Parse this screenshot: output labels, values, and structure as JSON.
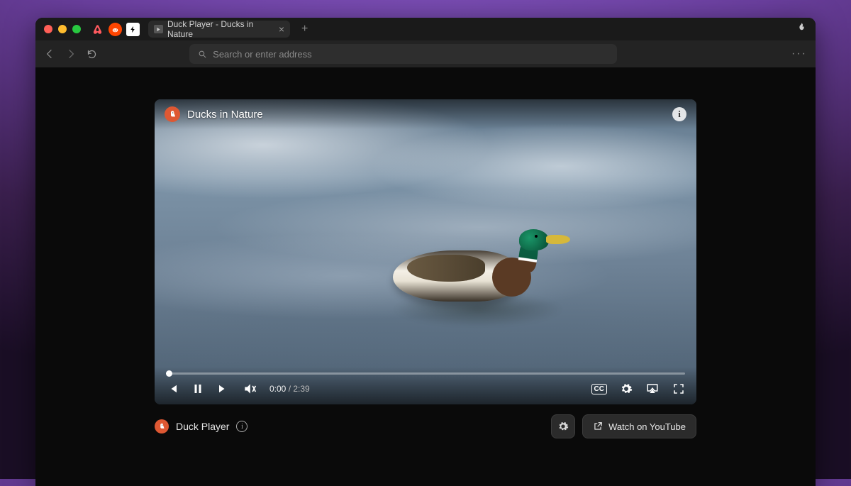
{
  "window": {
    "tab_title": "Duck Player - Ducks in Nature",
    "pinned_icons": [
      "airbnb",
      "reddit",
      "bolt"
    ]
  },
  "toolbar": {
    "search_placeholder": "Search or enter address"
  },
  "video": {
    "title": "Ducks in Nature",
    "current_time": "0:00",
    "duration": "2:39",
    "time_separator": " / "
  },
  "below": {
    "app_label": "Duck Player",
    "watch_label": "Watch on YouTube"
  },
  "icons": {
    "cc": "CC"
  }
}
